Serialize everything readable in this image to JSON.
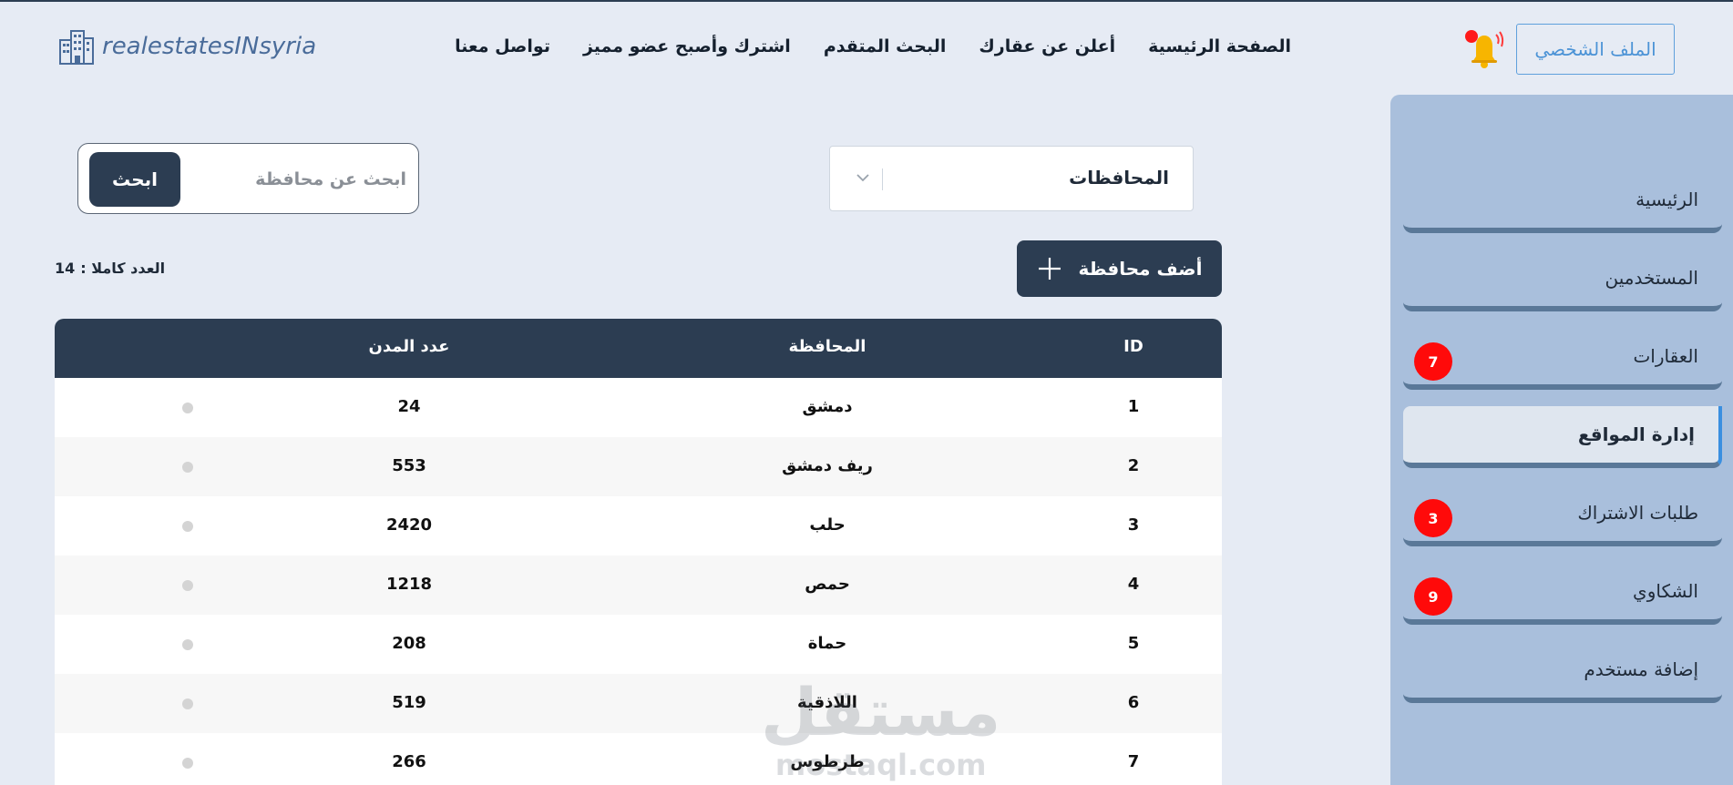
{
  "header": {
    "logo_text": "realestatesINsyria",
    "nav": [
      "الصفحة الرئيسية",
      "أعلن عن عقارك",
      "البحث المتقدم",
      "اشترك وأصبح عضو مميز",
      "تواصل معنا"
    ],
    "profile_label": "الملف الشخصي"
  },
  "sidebar": {
    "items": [
      {
        "label": "الرئيسية",
        "badge": null
      },
      {
        "label": "المستخدمين",
        "badge": null
      },
      {
        "label": "العقارات",
        "badge": "7"
      },
      {
        "label": "إدارة المواقع",
        "badge": null
      },
      {
        "label": "طلبات الاشتراك",
        "badge": "3"
      },
      {
        "label": "الشكاوي",
        "badge": "9"
      },
      {
        "label": "إضافة مستخدم",
        "badge": null
      }
    ],
    "active_index": 3
  },
  "controls": {
    "search_placeholder": "ابحث عن محافظة",
    "search_button": "ابحث",
    "select_value": "المحافظات",
    "add_button": "أضف محافظة",
    "total_label": "العدد كاملا :",
    "total_value": "14"
  },
  "table": {
    "headers": [
      "ID",
      "المحافظة",
      "عدد المدن"
    ],
    "rows": [
      {
        "id": "1",
        "name": "دمشق",
        "cities": "24"
      },
      {
        "id": "2",
        "name": "ريف دمشق",
        "cities": "553"
      },
      {
        "id": "3",
        "name": "حلب",
        "cities": "2420"
      },
      {
        "id": "4",
        "name": "حمص",
        "cities": "1218"
      },
      {
        "id": "5",
        "name": "حماة",
        "cities": "208"
      },
      {
        "id": "6",
        "name": "اللاذقية",
        "cities": "519"
      },
      {
        "id": "7",
        "name": "طرطوس",
        "cities": "266"
      }
    ]
  },
  "watermark": {
    "line1": "مستقل",
    "line2": "mostaql.com"
  },
  "colors": {
    "primary": "#2c3d52",
    "sidebar": "#a9bfdc",
    "badge": "#ff0a0a",
    "background": "#e6ebf4",
    "accent": "#4c93d6"
  }
}
